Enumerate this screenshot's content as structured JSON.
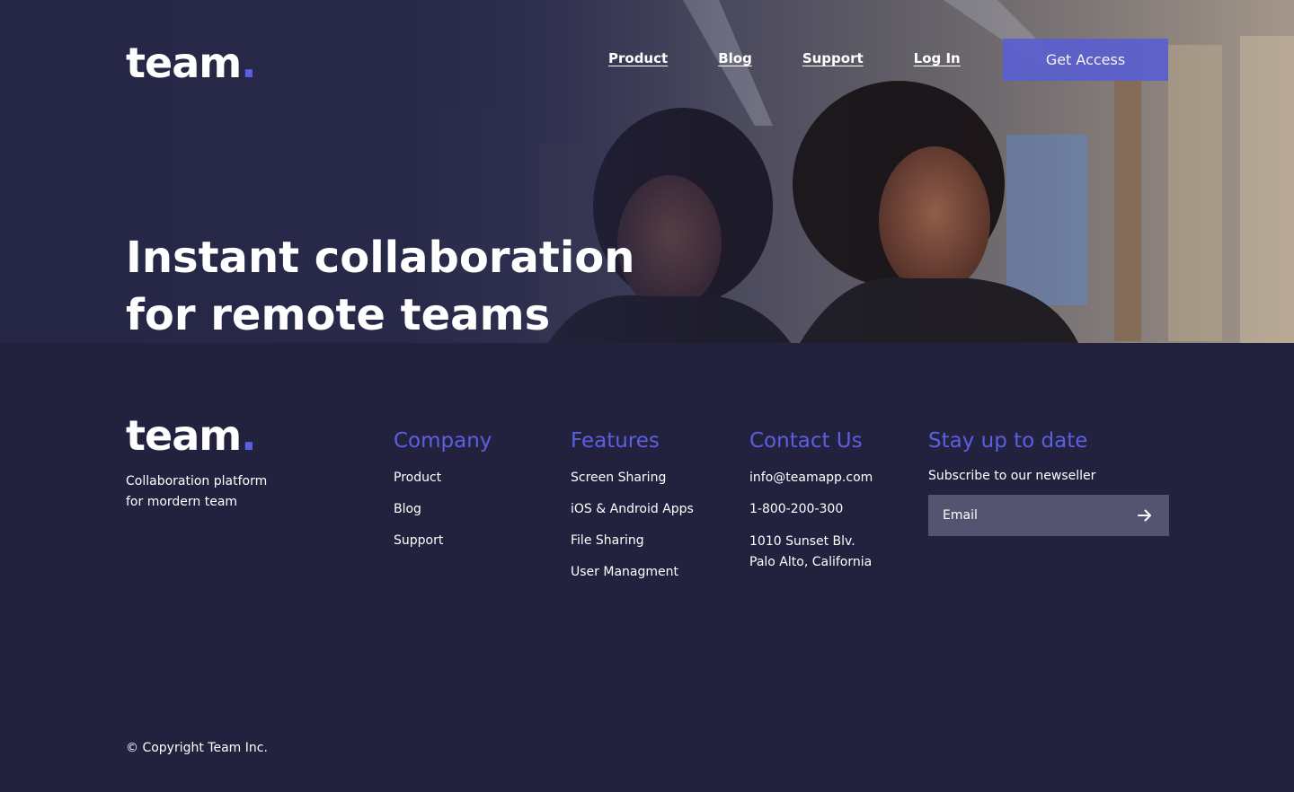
{
  "brand": {
    "name": "team",
    "dot": "."
  },
  "nav": {
    "links": [
      "Product",
      "Blog",
      "Support",
      "Log In"
    ],
    "cta": "Get Access"
  },
  "hero": {
    "title_line1": "Instant collaboration",
    "title_line2": "for remote teams"
  },
  "footer": {
    "tagline_line1": "Collaboration platform",
    "tagline_line2": "for mordern team",
    "company": {
      "heading": "Company",
      "items": [
        "Product",
        "Blog",
        "Support"
      ]
    },
    "features": {
      "heading": "Features",
      "items": [
        "Screen Sharing",
        "iOS & Android Apps",
        "File Sharing",
        "User Managment"
      ]
    },
    "contact": {
      "heading": "Contact Us",
      "email": "info@teamapp.com",
      "phone": "1-800-200-300",
      "address_line1": "1010 Sunset Blv.",
      "address_line2": "Palo Alto, California"
    },
    "newsletter": {
      "heading": "Stay up to date",
      "subtitle": "Subscribe to our newseller",
      "placeholder": "Email"
    },
    "copyright": "© Copyright Team Inc."
  },
  "colors": {
    "background": "#22223f",
    "accent": "#5b5fe0",
    "cta": "#5b5fcf",
    "input": "#545470"
  },
  "icons": {
    "submit": "arrow-right-icon"
  }
}
